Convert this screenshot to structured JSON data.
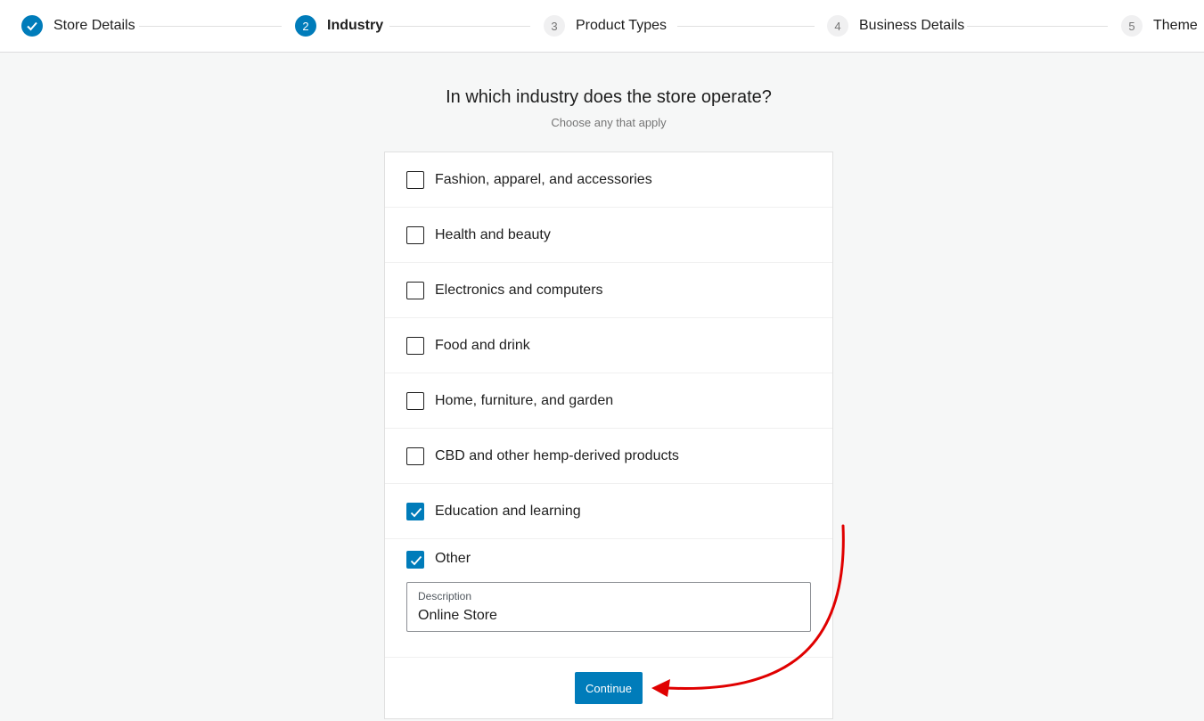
{
  "stepper": {
    "steps": [
      {
        "number": "1",
        "label": "Store Details",
        "state": "done"
      },
      {
        "number": "2",
        "label": "Industry",
        "state": "active"
      },
      {
        "number": "3",
        "label": "Product Types",
        "state": "pending"
      },
      {
        "number": "4",
        "label": "Business Details",
        "state": "pending"
      },
      {
        "number": "5",
        "label": "Theme",
        "state": "pending"
      }
    ]
  },
  "page": {
    "title": "In which industry does the store operate?",
    "subtitle": "Choose any that apply"
  },
  "options": [
    {
      "label": "Fashion, apparel, and accessories",
      "checked": false
    },
    {
      "label": "Health and beauty",
      "checked": false
    },
    {
      "label": "Electronics and computers",
      "checked": false
    },
    {
      "label": "Food and drink",
      "checked": false
    },
    {
      "label": "Home, furniture, and garden",
      "checked": false
    },
    {
      "label": "CBD and other hemp-derived products",
      "checked": false
    },
    {
      "label": "Education and learning",
      "checked": true
    },
    {
      "label": "Other",
      "checked": true
    }
  ],
  "other_description": {
    "label": "Description",
    "value": "Online Store"
  },
  "actions": {
    "continue_label": "Continue"
  },
  "colors": {
    "accent": "#007cba",
    "annotation": "#e00000"
  }
}
